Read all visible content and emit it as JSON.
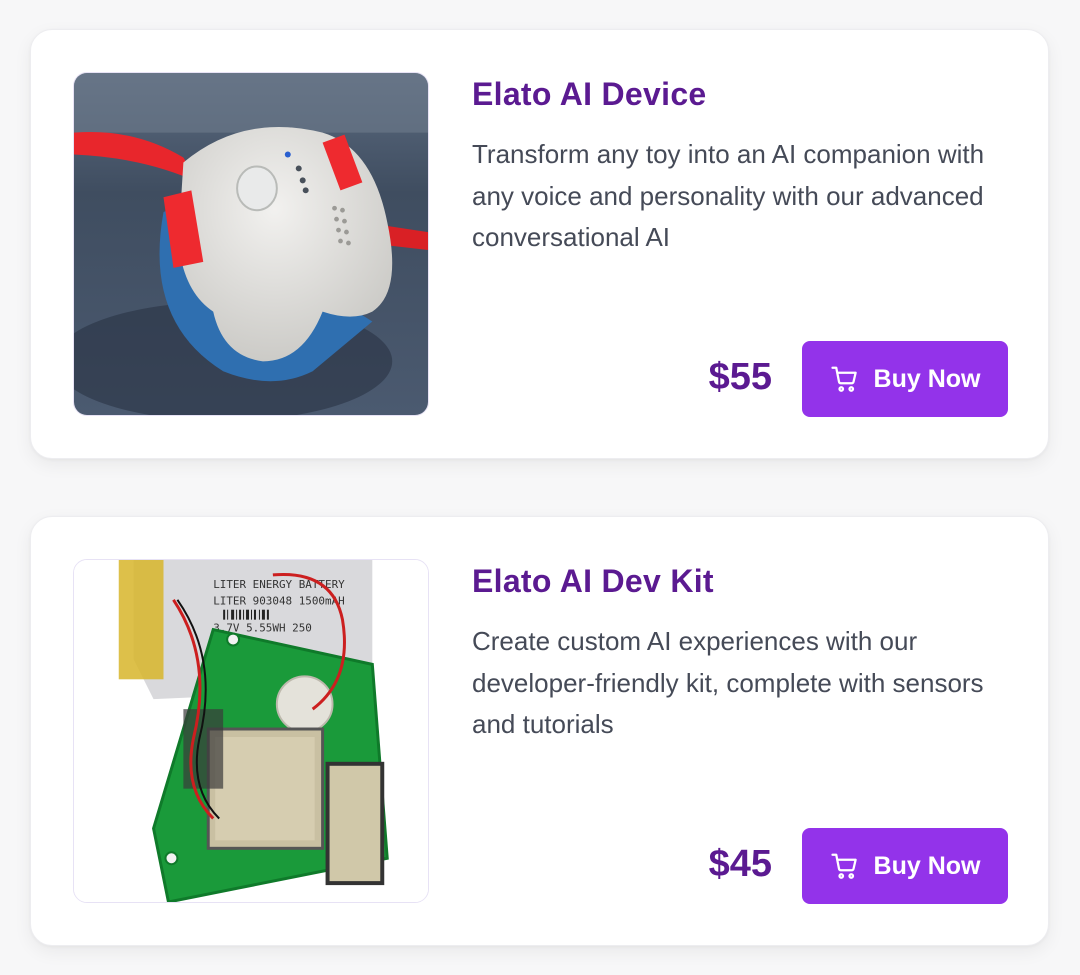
{
  "products": [
    {
      "title": "Elato AI Device",
      "description": "Transform any toy into an AI companion with any voice and personality with our advanced conversational AI",
      "price": "$55",
      "buy_label": "Buy Now",
      "image_icon": "ai-device-photo"
    },
    {
      "title": "Elato AI Dev Kit",
      "description": "Create custom AI experiences with our developer-friendly kit, complete with sensors and tutorials",
      "price": "$45",
      "buy_label": "Buy Now",
      "image_icon": "dev-kit-photo"
    }
  ],
  "colors": {
    "accent": "#9333ea",
    "title": "#5b1a91",
    "body_text": "#454a57",
    "background": "#f7f7f8"
  },
  "icons": {
    "buy": "shopping-cart-icon"
  }
}
